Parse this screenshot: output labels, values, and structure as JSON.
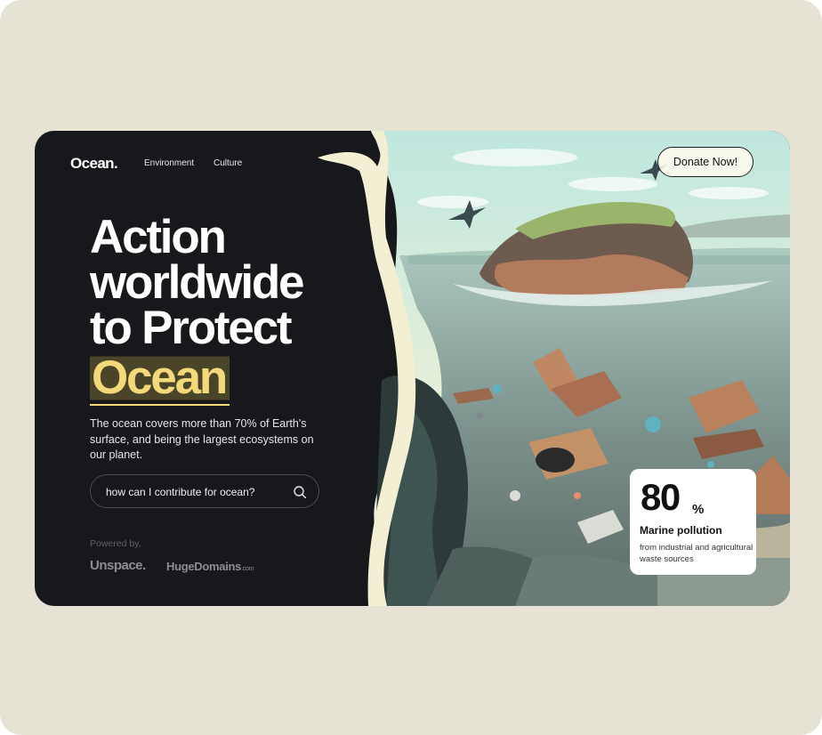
{
  "brand": {
    "logo": "Ocean."
  },
  "nav": {
    "items": [
      "Environment",
      "Culture"
    ]
  },
  "hero": {
    "headline_lines": [
      "Action",
      "worldwide",
      "to Protect"
    ],
    "highlight": "Ocean",
    "description": "The ocean covers more than 70% of Earth's surface, and being the largest ecosystems on our planet."
  },
  "search": {
    "value": "how can I contribute for ocean?",
    "icon": "search-icon"
  },
  "powered": {
    "label": "Powered by,",
    "sponsors": [
      "Unspace.",
      "HugeDomains"
    ],
    "sponsor2_suffix": ".com"
  },
  "cta": {
    "donate": "Donate Now!"
  },
  "stat": {
    "number": "80",
    "unit": "%",
    "title": "Marine pollution",
    "description": "from industrial and agricultural waste sources"
  },
  "colors": {
    "background": "#e6e3d4",
    "card": "#17181c",
    "accent": "#f4d97a",
    "cream": "#f3efd3"
  }
}
